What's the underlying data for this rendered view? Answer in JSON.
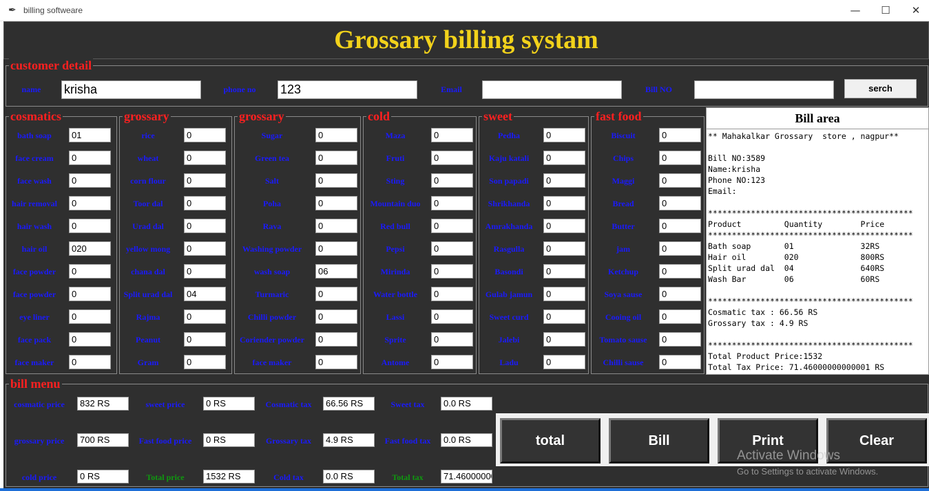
{
  "window": {
    "title": "billing softweare",
    "minimize": "—",
    "maximize": "☐",
    "close": "✕",
    "icon": "feather-icon"
  },
  "header": {
    "title": "Grossary billing systam"
  },
  "customer": {
    "legend": "customer detail",
    "name_label": "name",
    "name_value": "krisha",
    "phone_label": "phone no",
    "phone_value": "123",
    "email_label": "Email",
    "email_value": "",
    "bill_label": "Bill NO",
    "bill_value": "",
    "search_label": "serch"
  },
  "sections": [
    {
      "legend": "cosmatics",
      "items": [
        {
          "label": "bath soap",
          "value": "01"
        },
        {
          "label": "face cream",
          "value": "0"
        },
        {
          "label": "face wash",
          "value": "0"
        },
        {
          "label": "hair removal",
          "value": "0"
        },
        {
          "label": "hair wash",
          "value": "0"
        },
        {
          "label": "hair oil",
          "value": "020"
        },
        {
          "label": "face powder",
          "value": "0"
        },
        {
          "label": "face powder",
          "value": "0"
        },
        {
          "label": "eye liner",
          "value": "0"
        },
        {
          "label": "face pack",
          "value": "0"
        },
        {
          "label": "face maker",
          "value": "0"
        }
      ]
    },
    {
      "legend": "grossary",
      "items": [
        {
          "label": "rice",
          "value": "0"
        },
        {
          "label": "wheat",
          "value": "0"
        },
        {
          "label": "corn flour",
          "value": "0"
        },
        {
          "label": "Toor dal",
          "value": "0"
        },
        {
          "label": "Urad dal",
          "value": "0"
        },
        {
          "label": "yellow mong",
          "value": "0"
        },
        {
          "label": "chana dal",
          "value": "0"
        },
        {
          "label": "Split urad dal",
          "value": "04"
        },
        {
          "label": "Rajma",
          "value": "0"
        },
        {
          "label": "Peanut",
          "value": "0"
        },
        {
          "label": "Gram",
          "value": "0"
        }
      ]
    },
    {
      "legend": "grossary",
      "items": [
        {
          "label": "Sugar",
          "value": "0"
        },
        {
          "label": "Green tea",
          "value": "0"
        },
        {
          "label": "Salt",
          "value": "0"
        },
        {
          "label": "Poha",
          "value": "0"
        },
        {
          "label": "Rava",
          "value": "0"
        },
        {
          "label": "Washing powder",
          "value": "0"
        },
        {
          "label": "wash soap",
          "value": "06"
        },
        {
          "label": "Turmaric",
          "value": "0"
        },
        {
          "label": "Chilli powder",
          "value": "0"
        },
        {
          "label": "Coriender powder",
          "value": "0"
        },
        {
          "label": "face maker",
          "value": "0"
        }
      ]
    },
    {
      "legend": "cold",
      "items": [
        {
          "label": "Maza",
          "value": "0"
        },
        {
          "label": "Fruti",
          "value": "0"
        },
        {
          "label": "Sting",
          "value": "0"
        },
        {
          "label": "Mountain duo",
          "value": "0"
        },
        {
          "label": "Red bull",
          "value": "0"
        },
        {
          "label": "Pepsi",
          "value": "0"
        },
        {
          "label": "Mirinda",
          "value": "0"
        },
        {
          "label": "Water bottle",
          "value": "0"
        },
        {
          "label": "Lassi",
          "value": "0"
        },
        {
          "label": "Sprite",
          "value": "0"
        },
        {
          "label": "Antome",
          "value": "0"
        }
      ]
    },
    {
      "legend": "sweet",
      "items": [
        {
          "label": "Pedha",
          "value": "0"
        },
        {
          "label": "Kaju katali",
          "value": "0"
        },
        {
          "label": "Son papadi",
          "value": "0"
        },
        {
          "label": "Shrikhanda",
          "value": "0"
        },
        {
          "label": "Amrakhanda",
          "value": "0"
        },
        {
          "label": "Rasgulla",
          "value": "0"
        },
        {
          "label": "Basondi",
          "value": "0"
        },
        {
          "label": "Gulab jamun",
          "value": "0"
        },
        {
          "label": "Sweet curd",
          "value": "0"
        },
        {
          "label": "Jalebi",
          "value": "0"
        },
        {
          "label": "Ladu",
          "value": "0"
        }
      ]
    },
    {
      "legend": "fast food",
      "items": [
        {
          "label": "Biscuit",
          "value": "0"
        },
        {
          "label": "Chips",
          "value": "0"
        },
        {
          "label": "Maggi",
          "value": "0"
        },
        {
          "label": "Bread",
          "value": "0"
        },
        {
          "label": "Butter",
          "value": "0"
        },
        {
          "label": "jam",
          "value": "0"
        },
        {
          "label": "Ketchup",
          "value": "0"
        },
        {
          "label": "Soya sause",
          "value": "0"
        },
        {
          "label": "Cooing oil",
          "value": "0"
        },
        {
          "label": "Tomato sause",
          "value": "0"
        },
        {
          "label": "Chilli sause",
          "value": "0"
        }
      ]
    }
  ],
  "bill_area": {
    "title": "Bill area",
    "text": "** Mahakalkar Grossary  store , nagpur**\n\nBill NO:3589\nName:krisha\nPhone NO:123\nEmail:\n\n*******************************************\nProduct         Quantity        Price\n*******************************************\nBath soap       01              32RS\nHair oil        020             800RS\nSplit urad dal  04              640RS\nWash Bar        06              60RS\n\n*******************************************\nCosmatic tax : 66.56 RS\nGrossary tax : 4.9 RS\n\n*******************************************\nTotal Product Price:1532\nTotal Tax Price: 71.46000000000001 RS"
  },
  "bill_menu": {
    "legend": "bill menu",
    "fields": [
      {
        "label": "cosmatic price",
        "value": "832 RS",
        "green": false
      },
      {
        "label": "sweet price",
        "value": "0 RS",
        "green": false
      },
      {
        "label": "Cosmatic tax",
        "value": "66.56 RS",
        "green": false
      },
      {
        "label": "Sweet tax",
        "value": "0.0 RS",
        "green": false
      },
      {
        "label": "grossary price",
        "value": "700 RS",
        "green": false
      },
      {
        "label": "Fast food price",
        "value": "0 RS",
        "green": false
      },
      {
        "label": "Grossary tax",
        "value": "4.9 RS",
        "green": false
      },
      {
        "label": "Fast food tax",
        "value": "0.0 RS",
        "green": false
      },
      {
        "label": "cold price",
        "value": "0 RS",
        "green": false
      },
      {
        "label": "Total price",
        "value": "1532 RS",
        "green": true
      },
      {
        "label": "Cold tax",
        "value": "0.0 RS",
        "green": false
      },
      {
        "label": "Total tax",
        "value": "71.46000000",
        "green": true
      }
    ]
  },
  "buttons": {
    "total": "total",
    "bill": "Bill",
    "print": "Print",
    "clear": "Clear"
  },
  "watermark": {
    "line1": "Activate Windows",
    "line2": "Go to Settings to activate Windows."
  },
  "colors": {
    "background": "#2f2f2f",
    "title": "#f2d21b",
    "legend": "#ff2020",
    "label": "#1a1aff",
    "total_label": "#0f9a0f"
  }
}
